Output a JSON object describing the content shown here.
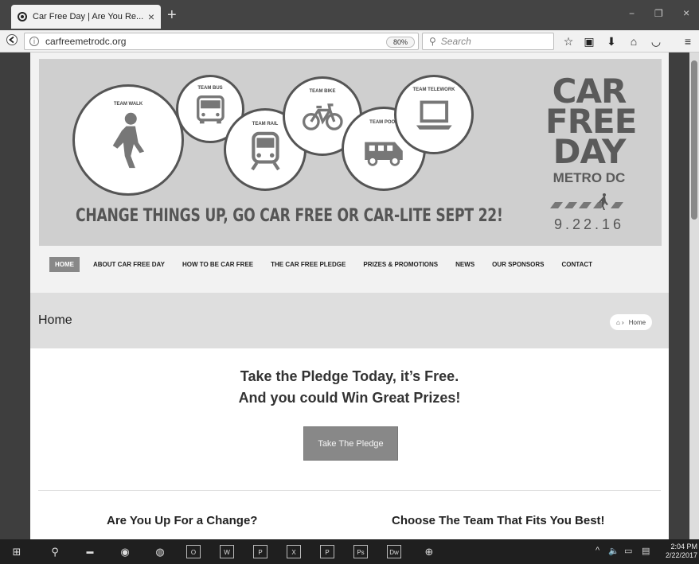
{
  "browser": {
    "tab_title": "Car Free Day | Are You Re...",
    "tab_close": "×",
    "new_tab": "+",
    "minimize": "−",
    "restore": "❐",
    "close": "×",
    "url": "carfreemetrodc.org",
    "zoom": "80%",
    "search_placeholder": "Search"
  },
  "banner": {
    "teams": [
      "TEAM WALK",
      "TEAM BUS",
      "TEAM RAIL",
      "TEAM BIKE",
      "TEAM POOL",
      "TEAM TELEWORK"
    ],
    "slogan": "CHANGE THINGS UP, GO CAR FREE OR CAR-LITE SEPT 22!",
    "logo_line1": "CAR",
    "logo_line2": "FREE",
    "logo_line3": "DAY",
    "logo_metro": "METRO DC",
    "logo_date": "9.22.16"
  },
  "menu": {
    "items": [
      "HOME",
      "ABOUT CAR FREE DAY",
      "HOW TO BE CAR FREE",
      "THE CAR FREE PLEDGE",
      "PRIZES & PROMOTIONS",
      "NEWS",
      "OUR SPONSORS",
      "CONTACT"
    ]
  },
  "page": {
    "title": "Home",
    "breadcrumb": "Home"
  },
  "content": {
    "pledge_line1": "Take the Pledge Today, it’s Free.",
    "pledge_line2": "And you could Win Great Prizes!",
    "pledge_button": "Take The Pledge",
    "col1_heading": "Are You Up For a Change?",
    "col2_heading": "Choose The Team That Fits You Best!"
  },
  "taskbar": {
    "clock_time": "2:04 PM",
    "clock_date": "2/22/2017",
    "apps": [
      "O",
      "W",
      "P",
      "X",
      "P",
      "Ps",
      "Dw"
    ]
  }
}
